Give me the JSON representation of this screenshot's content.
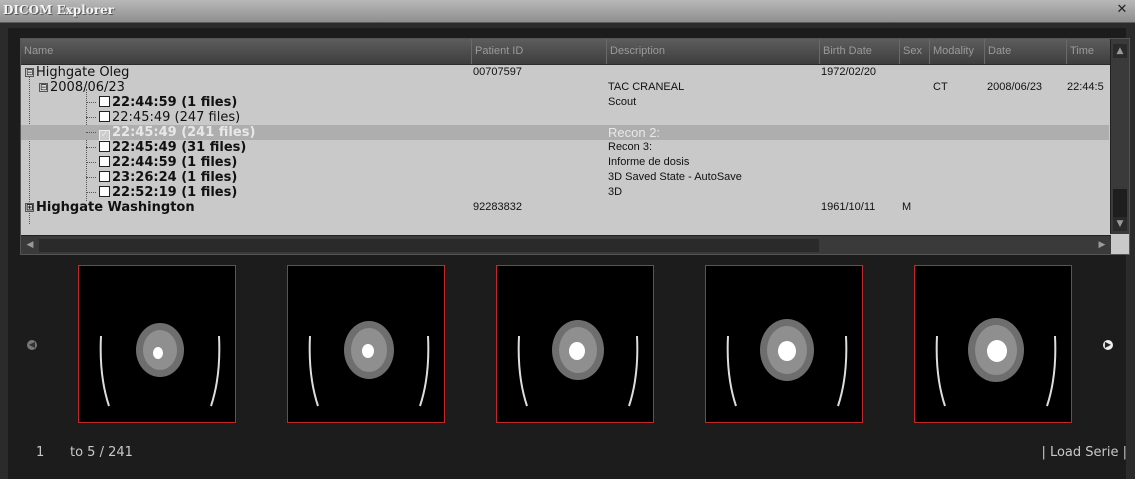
{
  "window": {
    "title": "DICOM Explorer",
    "close_icon": "close-icon"
  },
  "table": {
    "columns": [
      "Name",
      "Patient ID",
      "Description",
      "Birth Date",
      "Sex",
      "Modality",
      "Date",
      "Time"
    ],
    "rows": [
      {
        "name": "Highgate Oleg",
        "expander": "⊟",
        "patient_id": "00707597",
        "description": "",
        "birth_date": "1972/02/20",
        "sex": "",
        "modality": "",
        "date": "",
        "time": ""
      },
      {
        "name": "2008/06/23",
        "expander": "⊟",
        "patient_id": "",
        "description": "TAC CRANEAL",
        "birth_date": "",
        "sex": "",
        "modality": "CT",
        "date": "2008/06/23",
        "time": "22:44:5"
      },
      {
        "name": "22:44:59 (1 files)",
        "checked": false,
        "description": "Scout"
      },
      {
        "name": "22:45:49 (247 files)",
        "checked": false,
        "description": ""
      },
      {
        "name": "22:45:49 (241 files)",
        "checked": true,
        "description": "Recon 2:"
      },
      {
        "name": "22:45:49 (31 files)",
        "checked": false,
        "description": "Recon 3:"
      },
      {
        "name": "22:44:59 (1 files)",
        "checked": false,
        "description": "Informe de dosis"
      },
      {
        "name": "23:26:24 (1 files)",
        "checked": false,
        "description": "3D Saved State - AutoSave"
      },
      {
        "name": "22:52:19 (1 files)",
        "checked": false,
        "description": "3D"
      },
      {
        "name": "Highgate Washington",
        "expander": "⊞",
        "patient_id": "92283832",
        "description": "",
        "birth_date": "1961/10/11",
        "sex": "M",
        "modality": "",
        "date": "",
        "time": ""
      }
    ]
  },
  "preview": {
    "thumbnail_count": 5,
    "prev_icon": "chevron-left-icon",
    "next_icon": "chevron-right-icon"
  },
  "footer": {
    "page_start": "1",
    "range_text": "to 5 / 241",
    "load_button": "| Load Serie |"
  },
  "colors": {
    "frame": "#c0282a",
    "panel": "#c9c9c9",
    "background": "#2b2b2b"
  }
}
